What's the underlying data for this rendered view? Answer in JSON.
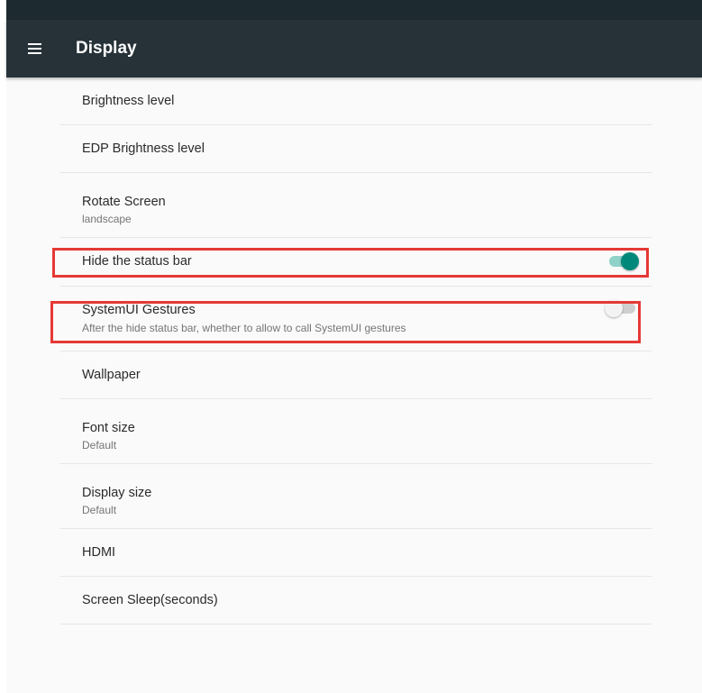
{
  "app_bar": {
    "title": "Display",
    "menu_icon": "hamburger-menu-icon",
    "background": "#263238"
  },
  "settings": [
    {
      "title": "Brightness level"
    },
    {
      "title": "EDP Brightness level"
    },
    {
      "title": "Rotate Screen",
      "summary": "landscape"
    },
    {
      "title": "Hide the status bar",
      "toggle": true,
      "checked": true,
      "highlighted": true
    },
    {
      "title": "SystemUI Gestures",
      "summary": "After the hide status bar, whether to allow to call SystemUI gestures",
      "toggle": true,
      "checked": false,
      "highlighted": true
    },
    {
      "title": "Wallpaper"
    },
    {
      "title": "Font size",
      "summary": "Default"
    },
    {
      "title": "Display size",
      "summary": "Default"
    },
    {
      "title": "HDMI"
    },
    {
      "title": "Screen Sleep(seconds)"
    }
  ],
  "colors": {
    "accent": "#00897b",
    "highlight_box": "#e53935"
  }
}
